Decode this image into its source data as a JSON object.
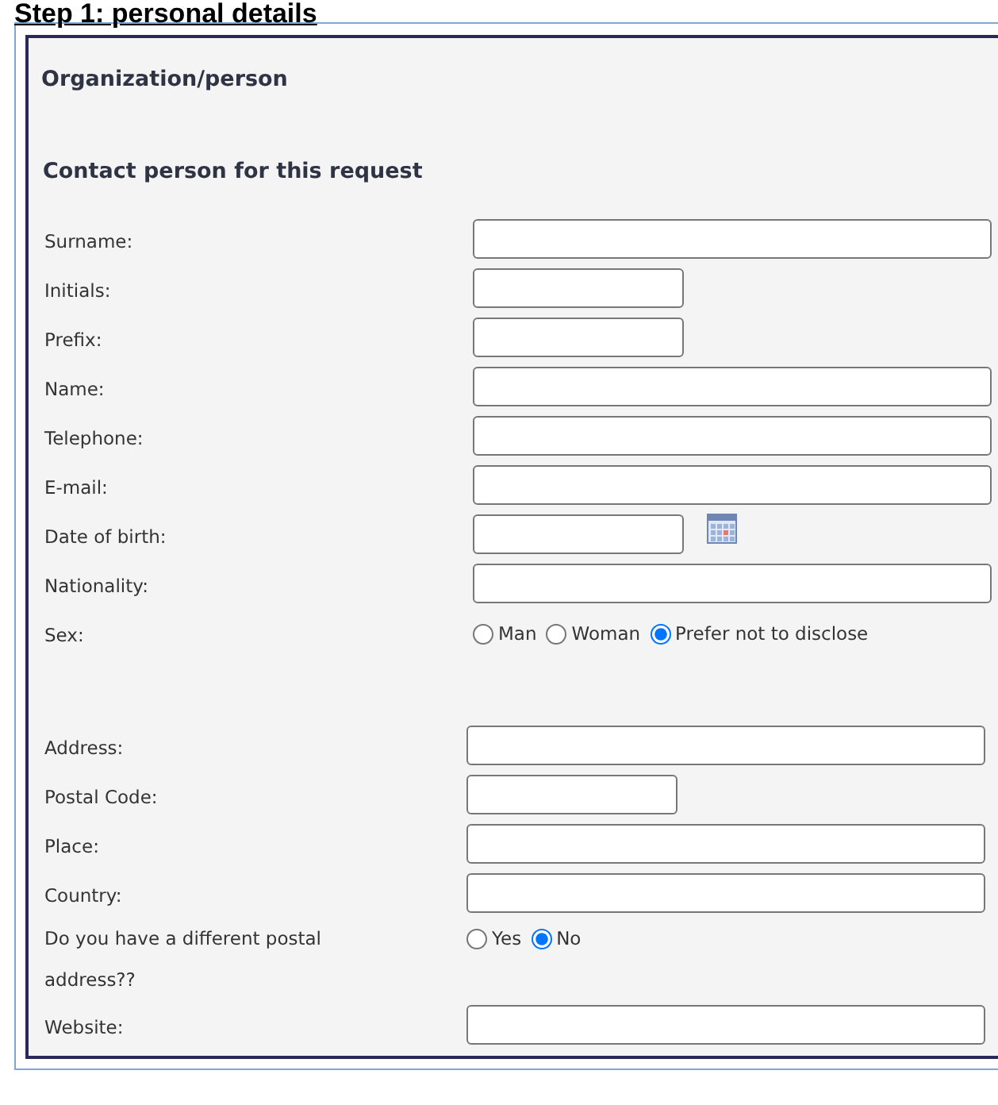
{
  "page_title": "Step 1: personal details",
  "section_title": "Organization/person",
  "subsection_title": "Contact person for this request",
  "groups": [
    {
      "fields": [
        {
          "kind": "text",
          "label": "Surname:",
          "wide": true
        },
        {
          "kind": "text",
          "label": "Initials:",
          "wide": false
        },
        {
          "kind": "text",
          "label": "Prefix:",
          "wide": false
        },
        {
          "kind": "text",
          "label": "Name:",
          "wide": true
        },
        {
          "kind": "text",
          "label": "Telephone:",
          "wide": true
        },
        {
          "kind": "text",
          "label": "E-mail:",
          "wide": true
        },
        {
          "kind": "date",
          "label": "Date of birth:",
          "wide": false
        },
        {
          "kind": "text",
          "label": "Nationality:",
          "wide": true
        },
        {
          "kind": "radio",
          "label": "Sex:",
          "options": [
            {
              "label": "Man",
              "selected": false
            },
            {
              "label": "Woman",
              "selected": false
            },
            {
              "label": "Prefer not to disclose",
              "selected": true
            }
          ]
        }
      ]
    },
    {
      "fields": [
        {
          "kind": "text",
          "label": "Address:",
          "wide": true
        },
        {
          "kind": "text",
          "label": "Postal Code:",
          "wide": false
        },
        {
          "kind": "text",
          "label": "Place:",
          "wide": true
        },
        {
          "kind": "text",
          "label": "Country:",
          "wide": true
        },
        {
          "kind": "radio",
          "label": "Do you have a different postal address??",
          "options": [
            {
              "label": "Yes",
              "selected": false
            },
            {
              "label": "No",
              "selected": true
            }
          ]
        },
        {
          "kind": "text",
          "label": "Website:",
          "wide": true
        }
      ]
    }
  ]
}
